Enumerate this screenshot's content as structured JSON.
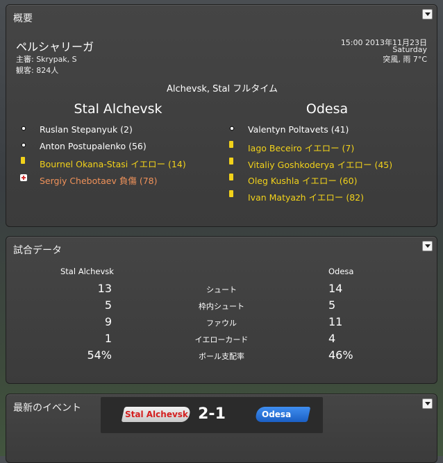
{
  "overview": {
    "title": "概要",
    "competition": "ペルシャリーガ",
    "referee": "主審: Skrypak, S",
    "attendance": "観客: 824人",
    "time": "15:00 2013年11月23日",
    "weekday": "Saturday",
    "weather": "突風, 雨 7°C",
    "status": "Alchevsk, Stal フルタイム",
    "home_team": "Stal Alchevsk",
    "away_team": "Odesa",
    "home_events": [
      {
        "icon": "goal",
        "text": "Ruslan Stepanyuk (2)"
      },
      {
        "icon": "goal",
        "text": "Anton Postupalenko (56)"
      },
      {
        "icon": "yellow-card",
        "text": "Bournel Okana-Stasi イエロー (14)"
      },
      {
        "icon": "injury",
        "text": "Sergiy Chebotaev 負傷 (78)"
      }
    ],
    "away_events": [
      {
        "icon": "goal",
        "text": "Valentyn Poltavets (41)"
      },
      {
        "icon": "yellow-card",
        "text": "Iago Beceiro イエロー (7)"
      },
      {
        "icon": "yellow-card",
        "text": "Vitaliy Goshkoderya イエロー (45)"
      },
      {
        "icon": "yellow-card",
        "text": "Oleg Kushla イエロー (60)"
      },
      {
        "icon": "yellow-card",
        "text": "Ivan Matyazh イエロー (82)"
      }
    ]
  },
  "match_stats": {
    "title": "試合データ",
    "home_team": "Stal Alchevsk",
    "away_team": "Odesa",
    "rows": [
      {
        "label": "シュート",
        "home": "13",
        "away": "14"
      },
      {
        "label": "枠内シュート",
        "home": "5",
        "away": "5"
      },
      {
        "label": "ファウル",
        "home": "9",
        "away": "11"
      },
      {
        "label": "イエローカード",
        "home": "1",
        "away": "4"
      },
      {
        "label": "ボール支配率",
        "home": "54%",
        "away": "46%"
      }
    ]
  },
  "latest_events": {
    "title": "最新のイベント",
    "home_team": "Stal Alchevsk",
    "away_team": "Odesa",
    "score": "2-1"
  },
  "colors": {
    "yellow_card": "#f2d21a",
    "injury": "#f0925a",
    "home_pill": "#e0e0e0",
    "home_text": "#d41f1f",
    "away_pill": "#1e6fd9"
  }
}
